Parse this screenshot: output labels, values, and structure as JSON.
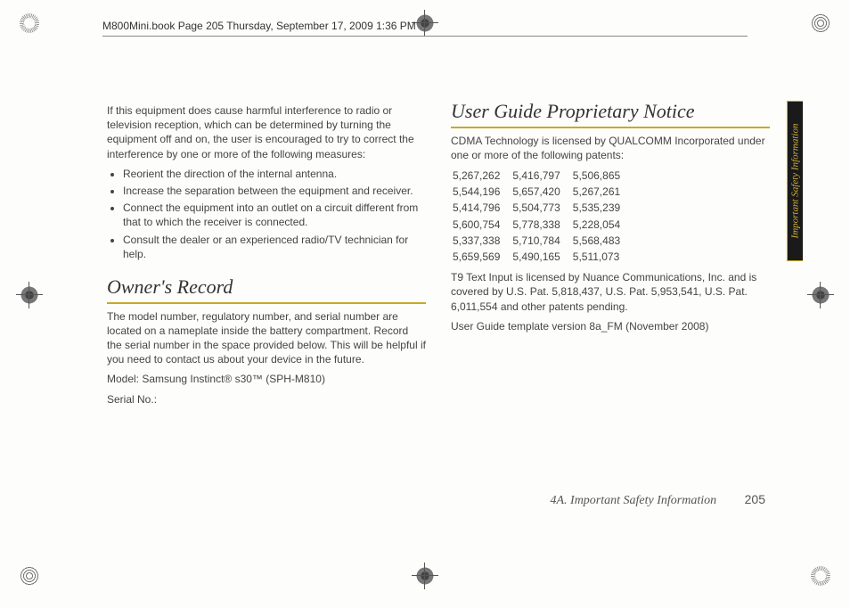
{
  "header": {
    "text": "M800Mini.book  Page 205  Thursday, September 17, 2009  1:36 PM"
  },
  "left": {
    "intro": "If this equipment does cause harmful interference to radio or television reception, which can be determined by turning the equipment off and on, the user is encouraged to try to correct the interference by one or more of the following measures:",
    "bullets": [
      "Reorient the direction of the internal antenna.",
      "Increase the separation between the equipment and receiver.",
      "Connect the equipment into an outlet on a circuit different from that to which the receiver is connected.",
      "Consult the dealer or an experienced radio/TV technician for help."
    ],
    "h_owner": "Owner's Record",
    "owner_p1": "The model number, regulatory number, and serial number are located on a nameplate inside the battery compartment. Record the serial number in the space provided below. This will be helpful if you need to contact us about your device in the future.",
    "owner_model": "Model: Samsung Instinct® s30™ (SPH-M810)",
    "owner_serial": "Serial No.:"
  },
  "right": {
    "h_notice": "User Guide Proprietary Notice",
    "cdma": "CDMA Technology is licensed by QUALCOMM Incorporated under one or more of the following patents:",
    "patents": [
      [
        "5,267,262",
        "5,416,797",
        "5,506,865"
      ],
      [
        "5,544,196",
        "5,657,420",
        "5,267,261"
      ],
      [
        "5,414,796",
        "5,504,773",
        "5,535,239"
      ],
      [
        "5,600,754",
        "5,778,338",
        "5,228,054"
      ],
      [
        "5,337,338",
        "5,710,784",
        "5,568,483"
      ],
      [
        "5,659,569",
        "5,490,165",
        "5,511,073"
      ]
    ],
    "t9": "T9 Text Input is licensed by Nuance Communications, Inc. and is covered by U.S. Pat. 5,818,437, U.S. Pat. 5,953,541, U.S. Pat. 6,011,554 and other patents pending.",
    "template": "User Guide template version 8a_FM (November 2008)"
  },
  "side_tab": "Important Safety Information",
  "footer": {
    "section": "4A. Important Safety Information",
    "page": "205"
  }
}
